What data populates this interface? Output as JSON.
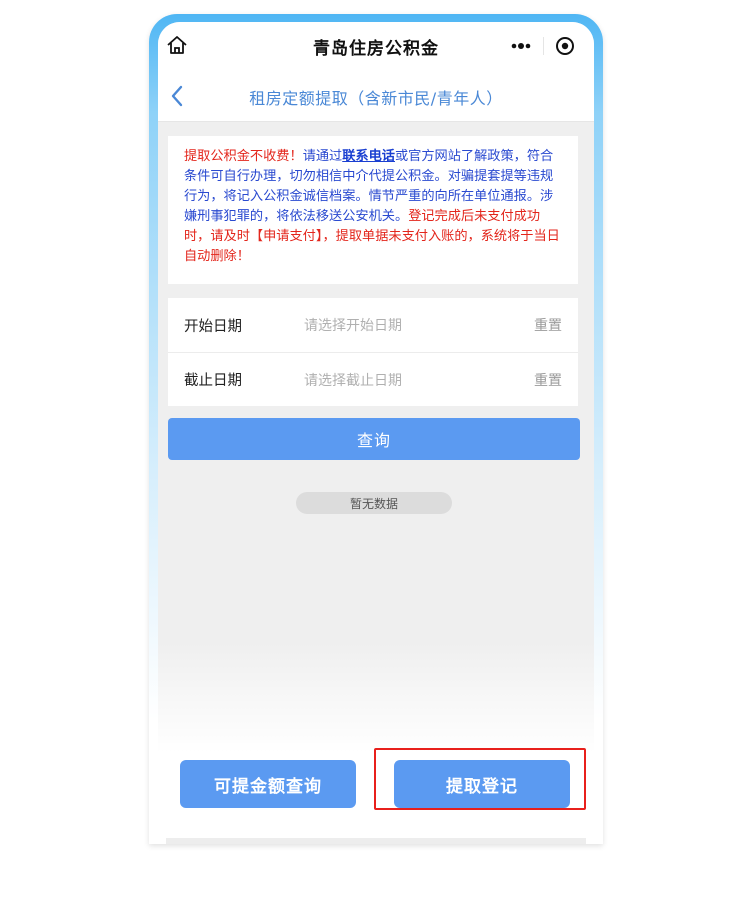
{
  "app": {
    "title": "青岛住房公积金"
  },
  "header": {
    "title": "租房定额提取（含新市民/青年人）"
  },
  "notice": {
    "part1_red": "提取公积金不收费！",
    "part2": "请通过",
    "link": "联系电话",
    "part3": "或官方网站了解政策，符合条件可自行办理，切勿相信中介代提公积金。对骗提套提等违规行为，将记入公积金诚信档案。情节严重的向所在单位通报。涉嫌刑事犯罪的，将依法移送公安机关。",
    "part4_red": "登记完成后未支付成功时，请及时【申请支付】，提取单据未支付入账的，系统将于当日自动删除！"
  },
  "form": {
    "start_label": "开始日期",
    "start_placeholder": "请选择开始日期",
    "end_label": "截止日期",
    "end_placeholder": "请选择截止日期",
    "reset_label": "重置"
  },
  "query_button": "查询",
  "empty_text": "暂无数据",
  "buttons": {
    "left": "可提金额查询",
    "right": "提取登记"
  },
  "colors": {
    "accent": "#5b9af1",
    "title_blue": "#4a88d6",
    "notice_blue": "#2a4ad0",
    "notice_red": "#e3261c",
    "highlight_red": "#e8201c"
  },
  "icons": [
    "home-icon",
    "more-icon",
    "close-circle-icon",
    "back-chevron-icon"
  ]
}
